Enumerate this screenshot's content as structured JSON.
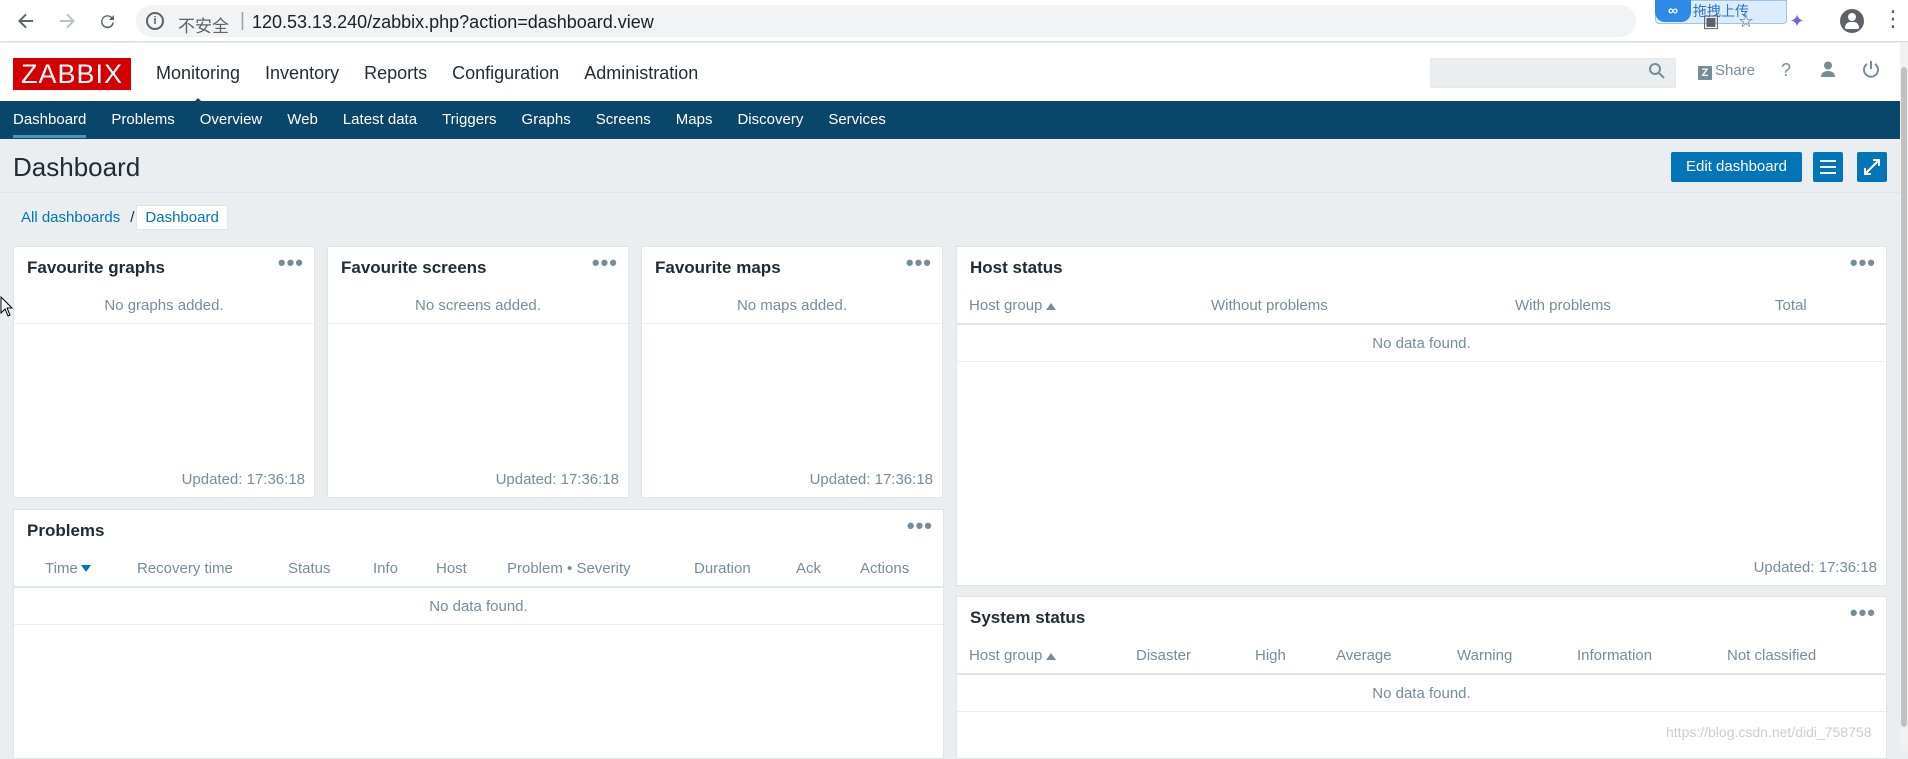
{
  "browser": {
    "insecure_label": "不安全",
    "url": "120.53.13.240/zabbix.php?action=dashboard.view",
    "extension_label": "拖拽上传"
  },
  "header": {
    "logo": "ZABBIX",
    "menu": [
      {
        "label": "Monitoring",
        "selected": true
      },
      {
        "label": "Inventory"
      },
      {
        "label": "Reports"
      },
      {
        "label": "Configuration"
      },
      {
        "label": "Administration"
      }
    ],
    "share_label": "Share",
    "help_label": "?"
  },
  "submenu": [
    {
      "label": "Dashboard",
      "selected": true
    },
    {
      "label": "Problems"
    },
    {
      "label": "Overview"
    },
    {
      "label": "Web"
    },
    {
      "label": "Latest data"
    },
    {
      "label": "Triggers"
    },
    {
      "label": "Graphs"
    },
    {
      "label": "Screens"
    },
    {
      "label": "Maps"
    },
    {
      "label": "Discovery"
    },
    {
      "label": "Services"
    }
  ],
  "page": {
    "title": "Dashboard",
    "edit_button": "Edit dashboard",
    "breadcrumb": {
      "all": "All dashboards",
      "separator": "/",
      "current": "Dashboard"
    }
  },
  "widgets": {
    "fav_graphs": {
      "title": "Favourite graphs",
      "empty": "No graphs added.",
      "updated": "Updated: 17:36:18"
    },
    "fav_screens": {
      "title": "Favourite screens",
      "empty": "No screens added.",
      "updated": "Updated: 17:36:18"
    },
    "fav_maps": {
      "title": "Favourite maps",
      "empty": "No maps added.",
      "updated": "Updated: 17:36:18"
    },
    "host_status": {
      "title": "Host status",
      "columns": [
        "Host group",
        "Without problems",
        "With problems",
        "Total"
      ],
      "empty": "No data found.",
      "updated": "Updated: 17:36:18"
    },
    "problems": {
      "title": "Problems",
      "columns": [
        "Time",
        "Recovery time",
        "Status",
        "Info",
        "Host",
        "Problem • Severity",
        "Duration",
        "Ack",
        "Actions"
      ],
      "empty": "No data found."
    },
    "system_status": {
      "title": "System status",
      "columns": [
        "Host group",
        "Disaster",
        "High",
        "Average",
        "Warning",
        "Information",
        "Not classified"
      ],
      "empty": "No data found."
    },
    "menu_glyph": "•••"
  },
  "watermark": "https://blog.csdn.net/didi_758758",
  "colors": {
    "accent": "#0275b8",
    "submenu_bg": "#0a466a",
    "logo_red": "#d40000"
  }
}
